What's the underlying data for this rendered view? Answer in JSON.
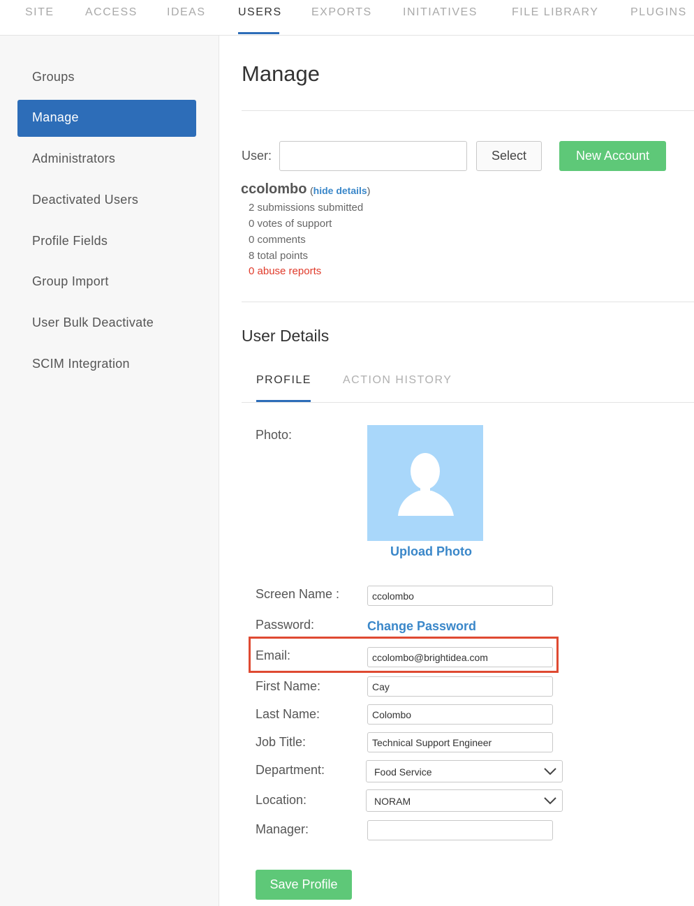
{
  "top_nav": {
    "tabs": [
      "SITE",
      "ACCESS",
      "IDEAS",
      "USERS",
      "EXPORTS",
      "INITIATIVES",
      "FILE LIBRARY",
      "PLUGINS"
    ],
    "active": "USERS"
  },
  "sidebar": {
    "items": [
      "Groups",
      "Manage",
      "Administrators",
      "Deactivated Users",
      "Profile Fields",
      "Group Import",
      "User Bulk Deactivate",
      "SCIM Integration"
    ],
    "active": "Manage"
  },
  "main": {
    "title": "Manage",
    "user_label": "User:",
    "user_input_value": "",
    "select_button": "Select",
    "new_account_button": "New Account",
    "username": "ccolombo",
    "hide_details_open": "(",
    "hide_details_link": "hide details",
    "hide_details_close": ")",
    "stats": [
      "2 submissions submitted",
      "0 votes of support",
      "0 comments",
      "8 total points"
    ],
    "abuse_reports": "0 abuse reports"
  },
  "user_details": {
    "title": "User Details",
    "tabs": [
      "PROFILE",
      "ACTION HISTORY"
    ],
    "active_tab": "PROFILE",
    "photo_label": "Photo:",
    "upload_photo": "Upload Photo",
    "fields": {
      "screen_name_label": "Screen Name :",
      "screen_name_value": "ccolombo",
      "password_label": "Password:",
      "change_password": "Change Password",
      "email_label": "Email:",
      "email_value": "ccolombo@brightidea.com",
      "first_name_label": "First Name:",
      "first_name_value": "Cay",
      "last_name_label": "Last Name:",
      "last_name_value": "Colombo",
      "job_title_label": "Job Title:",
      "job_title_value": "Technical Support Engineer",
      "department_label": "Department:",
      "department_value": "Food Service",
      "location_label": "Location:",
      "location_value": "NORAM",
      "manager_label": "Manager:",
      "manager_value": ""
    },
    "save_button": "Save Profile"
  },
  "colors": {
    "accent_blue": "#2d6db8",
    "link_blue": "#3a87c9",
    "green": "#5ec878",
    "red": "#e03a2a",
    "highlight": "#df4a32",
    "avatar_bg": "#a9d7fa"
  },
  "icons": [
    "avatar-silhouette-icon",
    "chevron-down-icon"
  ]
}
